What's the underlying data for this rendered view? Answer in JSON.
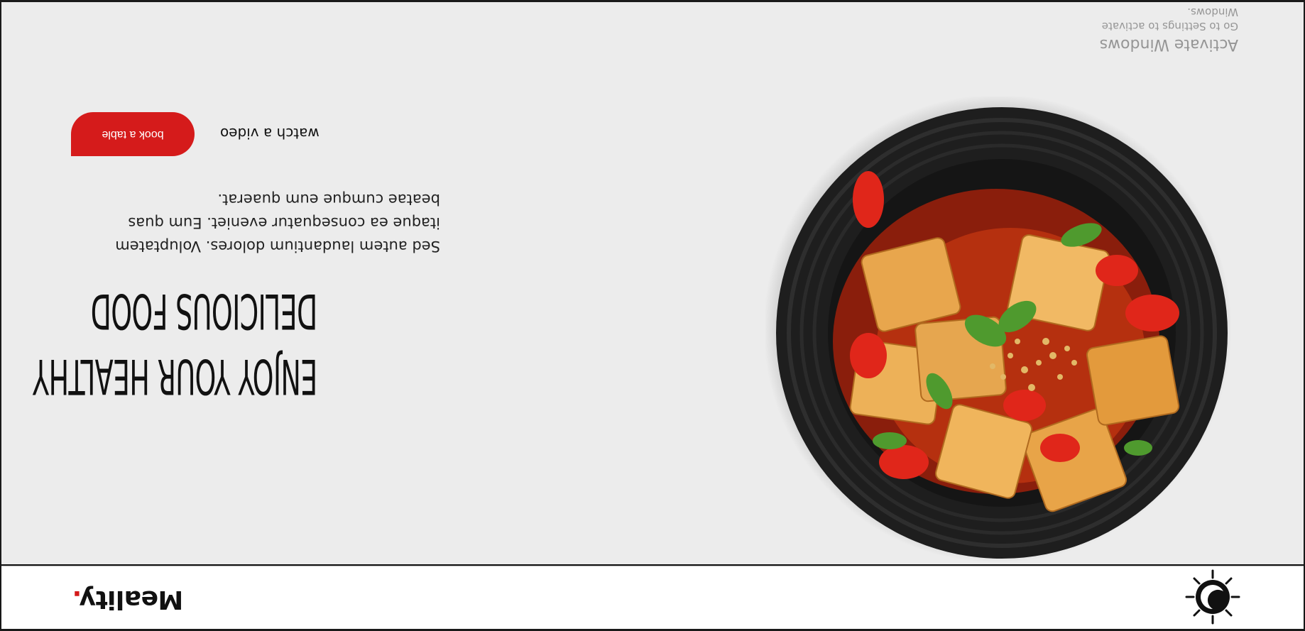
{
  "brand": {
    "name": "Meality",
    "dot": ".",
    "accent_color": "#d51b1b"
  },
  "nav": {
    "theme_toggle_icon": "sun-moon-icon"
  },
  "hero": {
    "title_lines": [
      "Enjoy your healthy",
      "delicious food"
    ],
    "description_lines": [
      "Sed autem laudantium dolores. Voluptatem",
      "itaque ea consequatur eveniet. Eum quas",
      "beatae cumque eum quaerat."
    ],
    "book_button": "book a table",
    "video_link": "watch a video",
    "image": "food-bowl-image"
  },
  "watermark": {
    "line1": "Activate Windows",
    "line2": "Go to Settings to activate Windows."
  },
  "colors": {
    "hero_bg": "#ececec",
    "navbar_bg": "#ffffff",
    "plate": "#1f1f1f"
  }
}
